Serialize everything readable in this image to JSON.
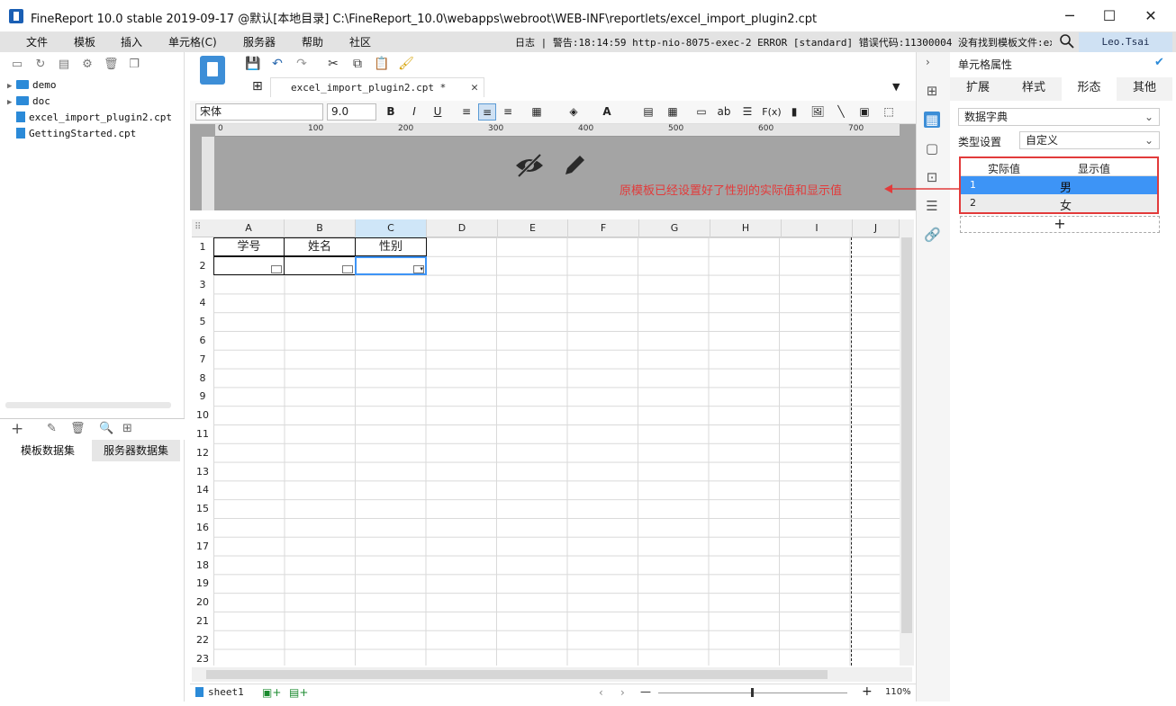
{
  "titlebar": {
    "title": "FineReport 10.0 stable 2019-09-17 @默认[本地目录]    C:\\FineReport_10.0\\webapps\\webroot\\WEB-INF\\reportlets/excel_import_plugin2.cpt",
    "minimize": "─",
    "maximize": "☐",
    "close": "✕"
  },
  "menu": {
    "items": [
      "文件",
      "模板",
      "插入",
      "单元格(C)",
      "服务器",
      "帮助",
      "社区"
    ],
    "log": "日志 | 警告:18:14:59 http-nio-8075-exec-2 ERROR [standard] 错误代码:11300004 没有找到模板文件:exc...",
    "user": "Leo.Tsai"
  },
  "tree": [
    {
      "type": "folder",
      "label": "demo"
    },
    {
      "type": "folder",
      "label": "doc"
    },
    {
      "type": "file",
      "label": "excel_import_plugin2.cpt"
    },
    {
      "type": "file",
      "label": "GettingStarted.cpt"
    }
  ],
  "left_tabs": [
    "模板数据集",
    "服务器数据集"
  ],
  "doc_tab": {
    "label": "excel_import_plugin2.cpt *",
    "close": "✕"
  },
  "format": {
    "font": "宋体",
    "size": "9.0",
    "bold": "B",
    "italic": "I",
    "underline": "U",
    "ab": "ab",
    "fx": "F(x)"
  },
  "ruler": [
    "0",
    "100",
    "200",
    "300",
    "400",
    "500",
    "600",
    "700"
  ],
  "columns": [
    "A",
    "B",
    "C",
    "D",
    "E",
    "F",
    "G",
    "H",
    "I",
    "J"
  ],
  "rows": [
    "1",
    "2",
    "3",
    "4",
    "5",
    "6",
    "7",
    "8",
    "9",
    "10",
    "11",
    "12",
    "13",
    "14",
    "15",
    "16",
    "17",
    "18",
    "19",
    "20",
    "21",
    "22",
    "23"
  ],
  "header_cells": [
    "学号",
    "姓名",
    "性别"
  ],
  "sheet": {
    "name": "sheet1",
    "zoom": "110%",
    "minus": "—",
    "plus": "+"
  },
  "right": {
    "title": "单元格属性",
    "tabs": [
      "扩展",
      "样式",
      "形态",
      "其他"
    ],
    "selected_tab": "形态",
    "type_label": "数据字典",
    "setting_label": "类型设置",
    "setting_value": "自定义",
    "dict_headers": [
      "实际值",
      "显示值"
    ],
    "dict_rows": [
      {
        "idx": "1",
        "val": "男"
      },
      {
        "idx": "2",
        "val": "女"
      }
    ],
    "add": "+"
  },
  "annotation": "原模板已经设置好了性别的实际值和显示值",
  "colors": {
    "accent": "#3d8ed7",
    "selection": "#3d94f6",
    "callout": "#e23b3b"
  }
}
